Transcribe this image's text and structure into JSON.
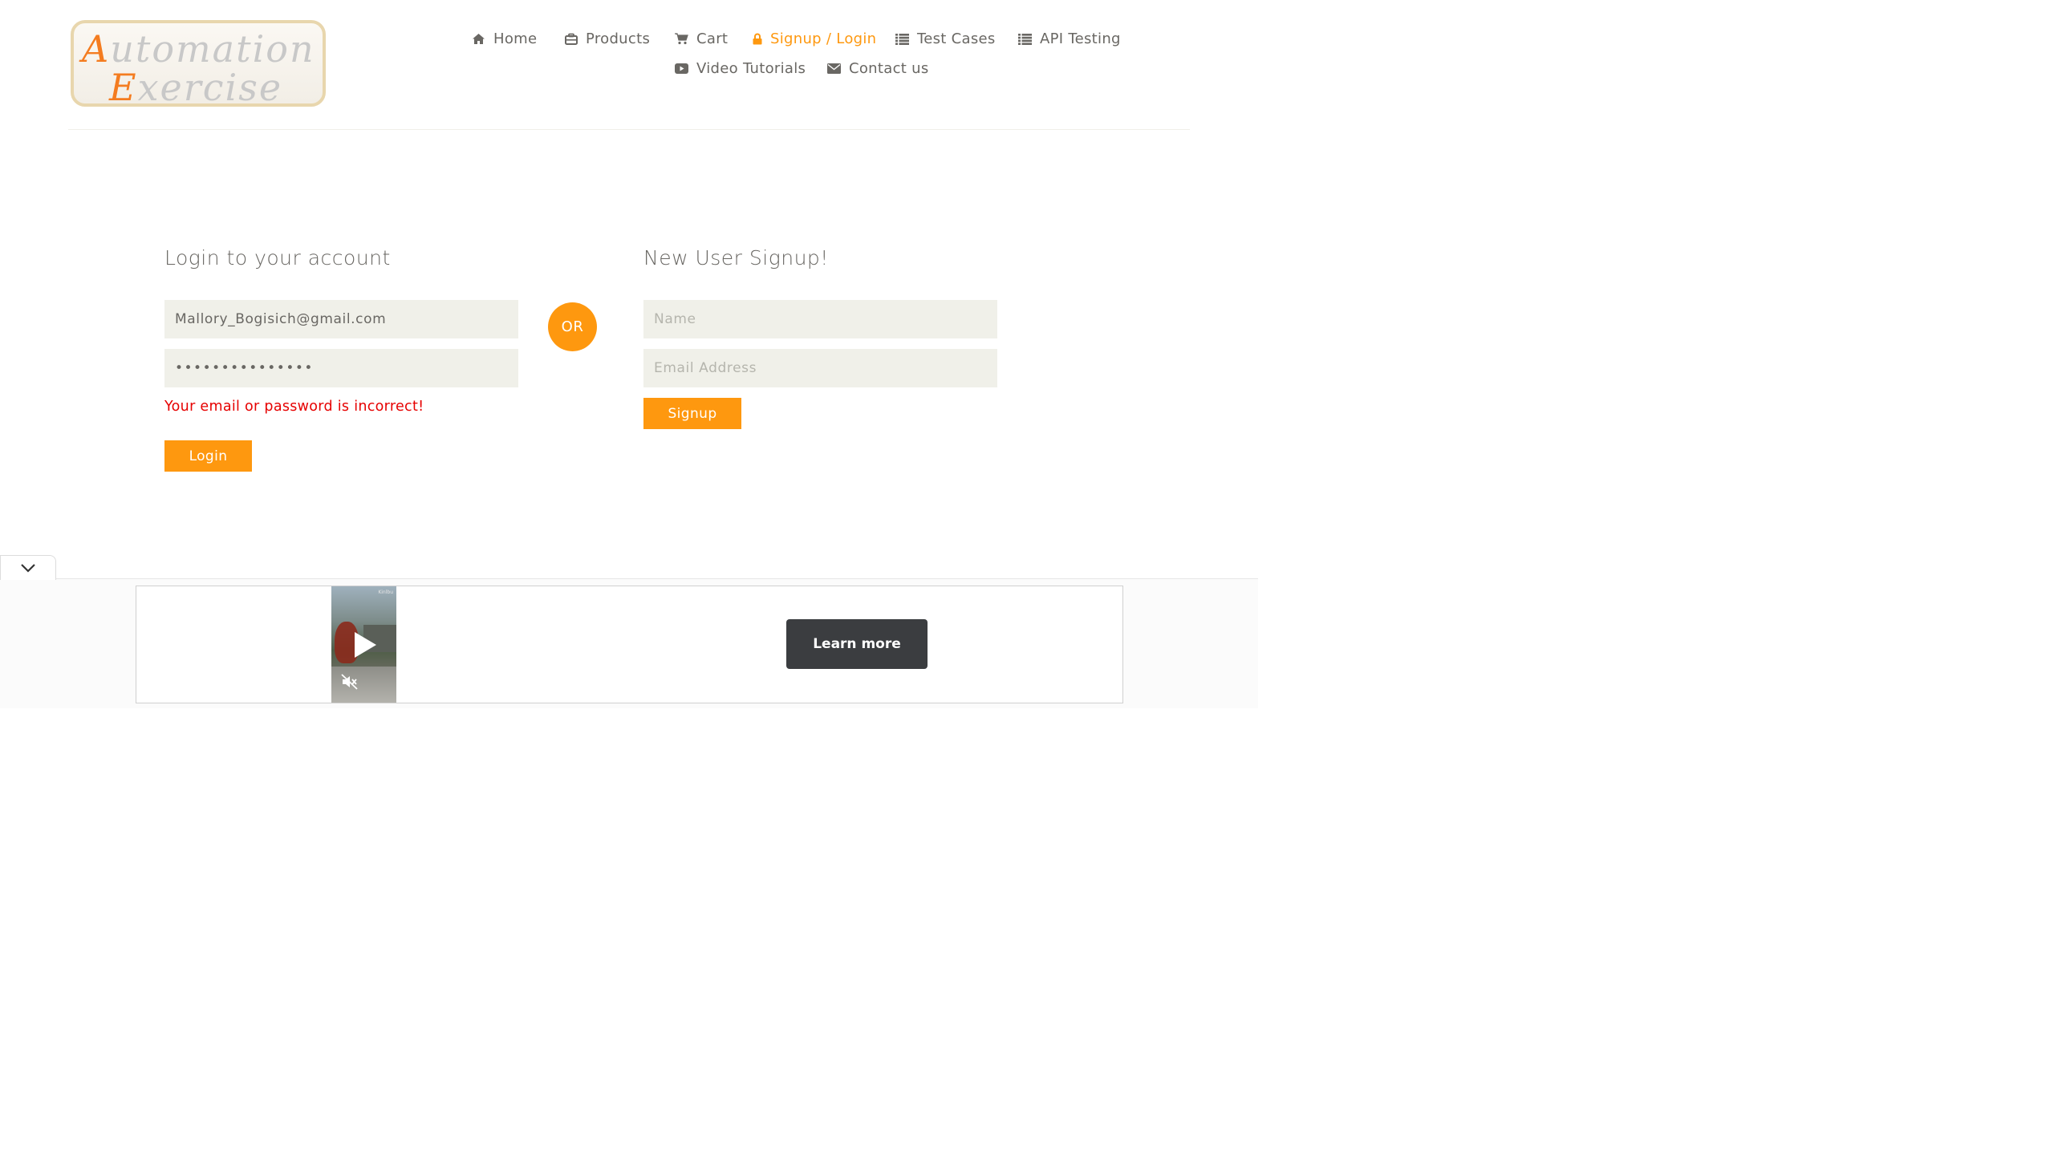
{
  "logo": {
    "line1_cap": "A",
    "line1_rest": "utomation",
    "line2_cap": "E",
    "line2_rest": "xercise"
  },
  "nav": {
    "home": "Home",
    "products": "Products",
    "cart": "Cart",
    "signup_login": "Signup / Login",
    "test_cases": "Test Cases",
    "api_testing": "API Testing",
    "video_tutorials": "Video Tutorials",
    "contact_us": "Contact us",
    "active_item": "signup_login",
    "active_color": "#fe980f"
  },
  "login": {
    "title": "Login to your account",
    "email_value": "Mallory_Bogisich@gmail.com",
    "password_value": "•••••••••••••••",
    "error": "Your email or password is incorrect!",
    "button": "Login"
  },
  "divider": {
    "or": "OR"
  },
  "signup": {
    "title": "New User Signup!",
    "name_placeholder": "Name",
    "email_placeholder": "Email Address",
    "button": "Signup"
  },
  "ad": {
    "learn_more": "Learn more",
    "video_brand": "Kinlbu"
  },
  "colors": {
    "accent": "#fe980f",
    "field_bg": "#f0f0e9",
    "error": "#e60000",
    "text": "#696763"
  },
  "icons": [
    "home-icon",
    "products-icon",
    "cart-icon",
    "lock-icon",
    "list-icon",
    "youtube-icon",
    "envelope-icon",
    "chevron-down-icon",
    "play-icon",
    "mute-icon"
  ]
}
